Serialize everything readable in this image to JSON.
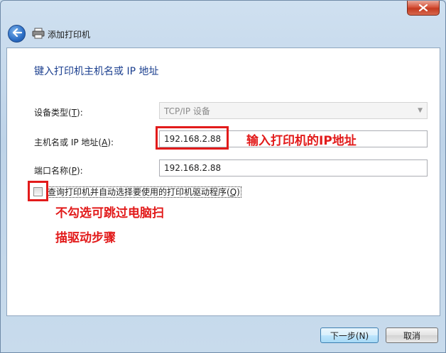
{
  "window": {
    "nav_title": "添加打印机",
    "close_icon": "close-icon",
    "colors": {
      "annotation": "#e21b1b",
      "heading": "#1b3f8f"
    }
  },
  "page": {
    "heading": "键入打印机主机名或 IP 地址",
    "device_type": {
      "label": "设备类型(",
      "accel": "T",
      "label_end": "):",
      "value": "TCP/IP 设备"
    },
    "hostname": {
      "label": "主机名或 IP 地址(",
      "accel": "A",
      "label_end": "):",
      "value": "192.168.2.88"
    },
    "port": {
      "label": "端口名称(",
      "accel": "P",
      "label_end": "):",
      "value": "192.168.2.88"
    },
    "query_checkbox": {
      "label": "查询打印机并自动选择要使用的打印机驱动程序(",
      "accel": "Q",
      "label_end": ")",
      "checked": false
    }
  },
  "annotations": {
    "ip_note": "输入打印机的IP地址",
    "checkbox_note_line1": "不勾选可跳过电脑扫",
    "checkbox_note_line2": "描驱动步骤"
  },
  "footer": {
    "next_label": "下一步(N)",
    "cancel_label": "取消"
  }
}
